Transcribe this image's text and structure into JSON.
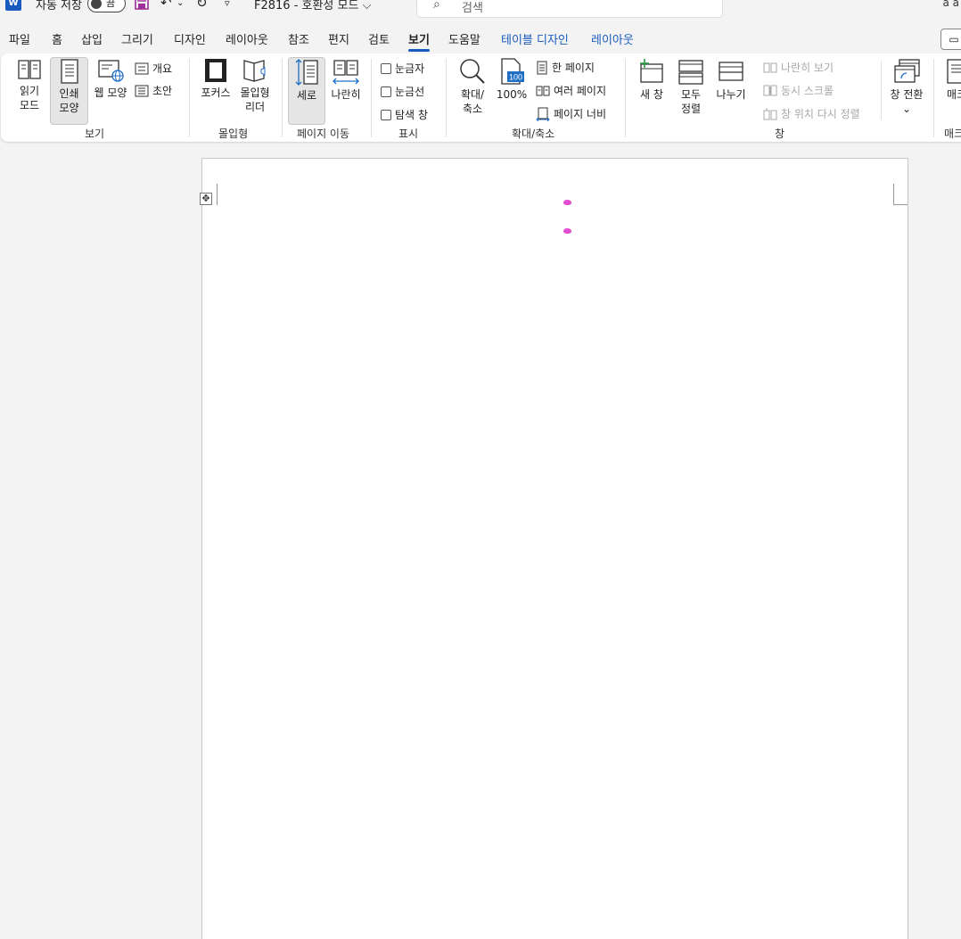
{
  "titlebar": {
    "app_logo": "W",
    "autosave_label": "자동 저장",
    "autosave_state": "끔",
    "save_icon": "save-icon",
    "undo_icon": "undo-icon",
    "redo_icon": "redo-icon",
    "customize_icon": "chevron-down-icon",
    "doc_title": "F2816  -  호환성 모드 ⌵",
    "search_placeholder": "검색",
    "user": "a a"
  },
  "tabs": [
    {
      "label": "파일"
    },
    {
      "label": "홈"
    },
    {
      "label": "삽입"
    },
    {
      "label": "그리기"
    },
    {
      "label": "디자인"
    },
    {
      "label": "레이아웃"
    },
    {
      "label": "참조"
    },
    {
      "label": "편지"
    },
    {
      "label": "검토"
    },
    {
      "label": "보기",
      "active": true
    },
    {
      "label": "도움말"
    },
    {
      "label": "테이블 디자인",
      "contextual": true
    },
    {
      "label": "레이아웃",
      "contextual": true
    }
  ],
  "ribbon": {
    "views": {
      "label": "보기",
      "read_mode": "읽기\n모드",
      "read_mode_l1": "읽기",
      "read_mode_l2": "모드",
      "print_layout_l1": "인쇄",
      "print_layout_l2": "모양",
      "web_layout": "웹 모양",
      "outline": "개요",
      "draft": "초안"
    },
    "immersive": {
      "label": "몰입형",
      "focus": "포커스",
      "reader_l1": "몰입형",
      "reader_l2": "리더"
    },
    "page_movement": {
      "label": "페이지 이동",
      "vertical": "세로",
      "side_to_side": "나란히"
    },
    "show": {
      "label": "표시",
      "ruler": "눈금자",
      "gridlines": "눈금선",
      "nav_pane": "탐색 창"
    },
    "zoom": {
      "label": "확대/축소",
      "zoom_l1": "확대/",
      "zoom_l2": "축소",
      "hundred": "100%",
      "hundred_badge": "100",
      "one_page": "한 페이지",
      "multiple_pages": "여러 페이지",
      "page_width": "페이지 너비"
    },
    "window": {
      "label": "창",
      "new_window": "새 창",
      "arrange_all_l1": "모두",
      "arrange_all_l2": "정렬",
      "split": "나누기",
      "view_side_by_side": "나란히 보기",
      "sync_scrolling": "동시 스크롤",
      "reset_position": "창 위치 다시 정렬",
      "switch_windows": "창 전환",
      "switch_chevron": "⌄"
    },
    "macros": {
      "label": "매크",
      "macro_btn": "매크"
    }
  }
}
